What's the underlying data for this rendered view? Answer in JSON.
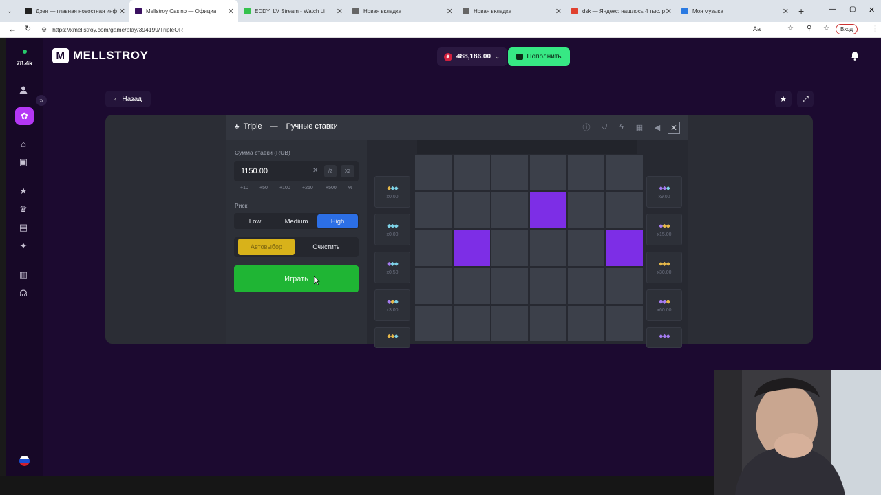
{
  "tabs": [
    {
      "label": "Дзен — главная новостная инф",
      "active": false,
      "favicon_color": "#222222"
    },
    {
      "label": "Mellstroy Casino — Официа",
      "active": true,
      "favicon_color": "#3a1060"
    },
    {
      "label": "EDDY_LV Stream - Watch Li",
      "active": false,
      "favicon_color": "#35c24d"
    },
    {
      "label": "Новая вкладка",
      "active": false,
      "favicon_color": "#666666"
    },
    {
      "label": "Новая вкладка",
      "active": false,
      "favicon_color": "#666666"
    },
    {
      "label": "dsk — Яндекс: нашлось 4 тыс. р",
      "active": false,
      "favicon_color": "#e0412f"
    },
    {
      "label": "Моя музыка",
      "active": false,
      "favicon_color": "#2a7ae2"
    }
  ],
  "browser": {
    "url": "https://xmellstroy.com/game/play/394199/TripleOR",
    "login_label": "Вход"
  },
  "sidebar": {
    "online_count": "78.4k",
    "icons": [
      "user-icon",
      "settings-icon",
      "home-icon",
      "gift-icon",
      "star-icon",
      "crown-icon",
      "cards-icon",
      "sparkle-icon",
      "document-icon",
      "support-icon",
      "flag-icon"
    ]
  },
  "header": {
    "logo_text": "MELLSTROY",
    "balance": "488,186.00",
    "deposit_label": "Пополнить"
  },
  "nav": {
    "back_label": "Назад"
  },
  "game": {
    "title": "Triple",
    "mode": "Ручные ставки",
    "bet_label": "Сумма ставки (RUB)",
    "bet_value": "1150.00",
    "half_label": "/2",
    "double_label": "X2",
    "quick_amounts": [
      "+10",
      "+50",
      "+100",
      "+250",
      "+500",
      "%"
    ],
    "risk_label": "Риск",
    "risk_options": [
      "Low",
      "Medium",
      "High"
    ],
    "risk_selected": "High",
    "auto_label": "Автовыбор",
    "clear_label": "Очистить",
    "play_label": "Играть",
    "grid": {
      "rows": 5,
      "cols": 6,
      "selected": [
        [
          1,
          3
        ],
        [
          2,
          1
        ],
        [
          2,
          5
        ]
      ]
    },
    "left_multipliers": [
      {
        "gems": [
          "y",
          "c",
          "c"
        ],
        "value": "x0.00"
      },
      {
        "gems": [
          "c",
          "c",
          "c"
        ],
        "value": "x0.00"
      },
      {
        "gems": [
          "p",
          "c",
          "c"
        ],
        "value": "x0.50"
      },
      {
        "gems": [
          "p",
          "y",
          "c"
        ],
        "value": "x3.00"
      },
      {
        "gems": [
          "y",
          "y",
          "c"
        ],
        "value": ""
      }
    ],
    "right_multipliers": [
      {
        "gems": [
          "p",
          "p",
          "c"
        ],
        "value": "x9.00"
      },
      {
        "gems": [
          "p",
          "y",
          "y"
        ],
        "value": "x15.00"
      },
      {
        "gems": [
          "y",
          "y",
          "y"
        ],
        "value": "x30.00"
      },
      {
        "gems": [
          "p",
          "p",
          "y"
        ],
        "value": "x60.00"
      },
      {
        "gems": [
          "p",
          "p",
          "p"
        ],
        "value": ""
      }
    ]
  }
}
